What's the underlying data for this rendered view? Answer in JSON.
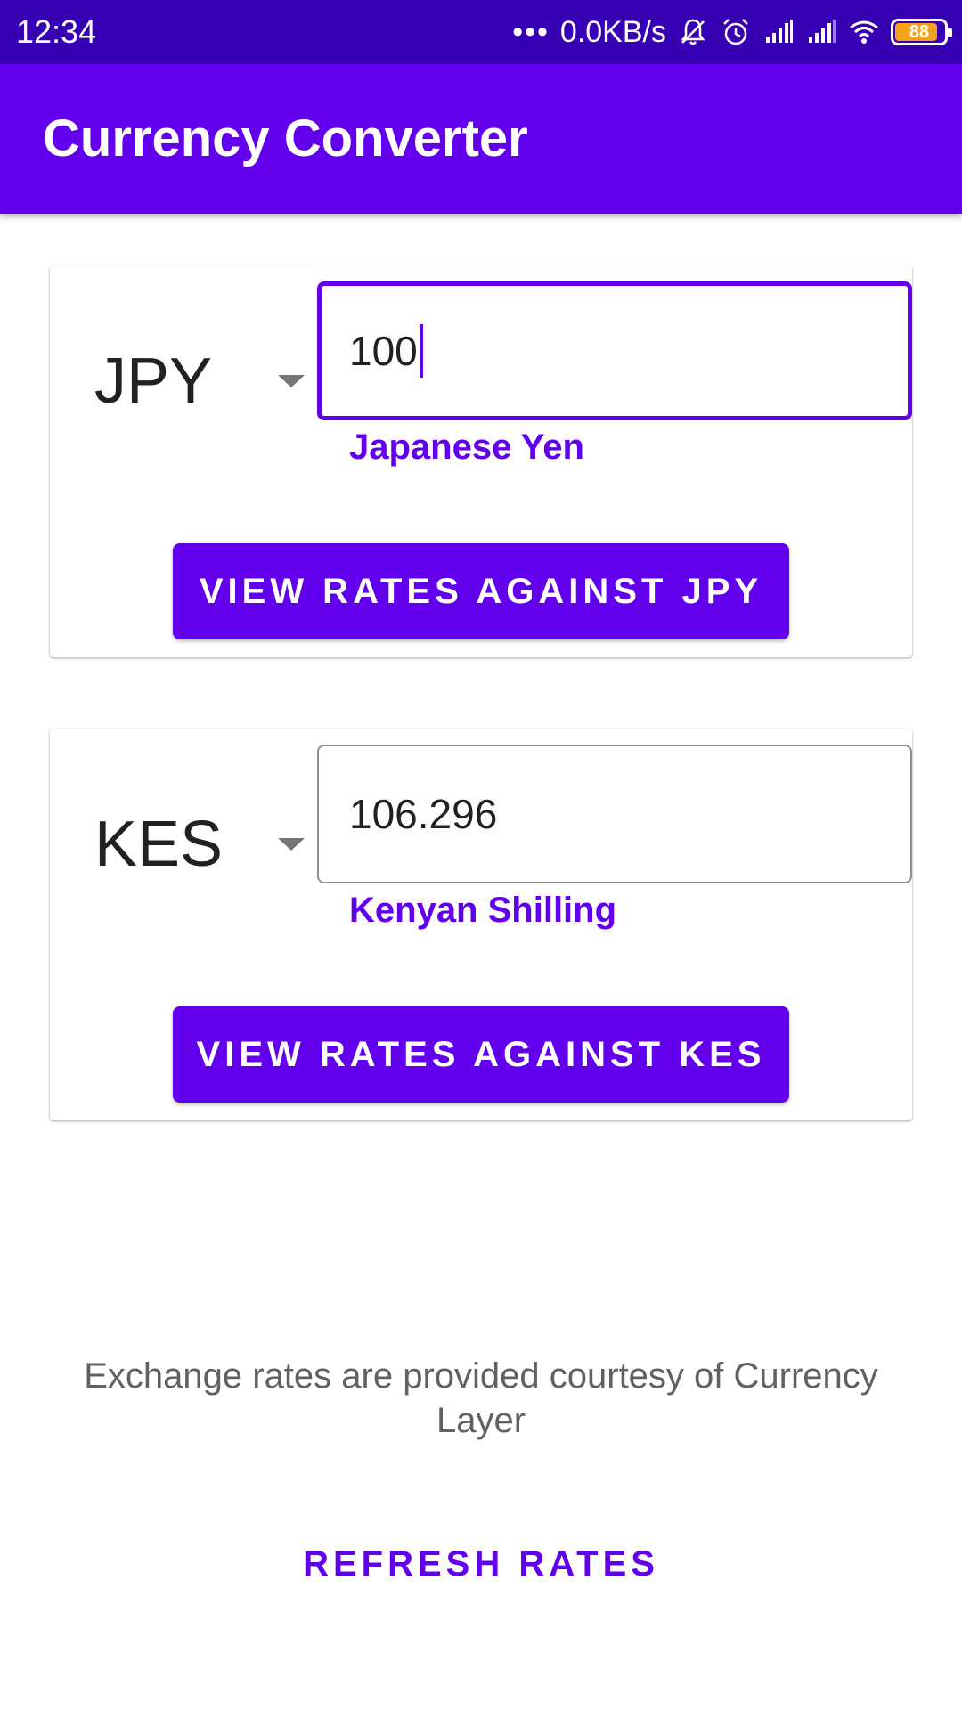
{
  "status_bar": {
    "time": "12:34",
    "dots": "•••",
    "network_speed": "0.0KB/s",
    "battery_level": "88",
    "battery_fraction": 0.88,
    "battery_color": "#f4a21b",
    "icons": [
      "mute-notification-icon",
      "alarm-icon",
      "signal-icon",
      "signal-icon",
      "wifi-icon",
      "battery-icon"
    ]
  },
  "app_bar": {
    "title": "Currency Converter",
    "color": "#6200ee"
  },
  "converter": [
    {
      "currency_code": "JPY",
      "amount": "100",
      "currency_name": "Japanese Yen",
      "button_label": "VIEW RATES AGAINST JPY",
      "focused": true
    },
    {
      "currency_code": "KES",
      "amount": "106.296",
      "currency_name": "Kenyan Shilling",
      "button_label": "VIEW RATES AGAINST KES",
      "focused": false
    }
  ],
  "footer": {
    "attribution": "Exchange rates are provided courtesy of Currency Layer",
    "refresh_label": "REFRESH RATES"
  }
}
